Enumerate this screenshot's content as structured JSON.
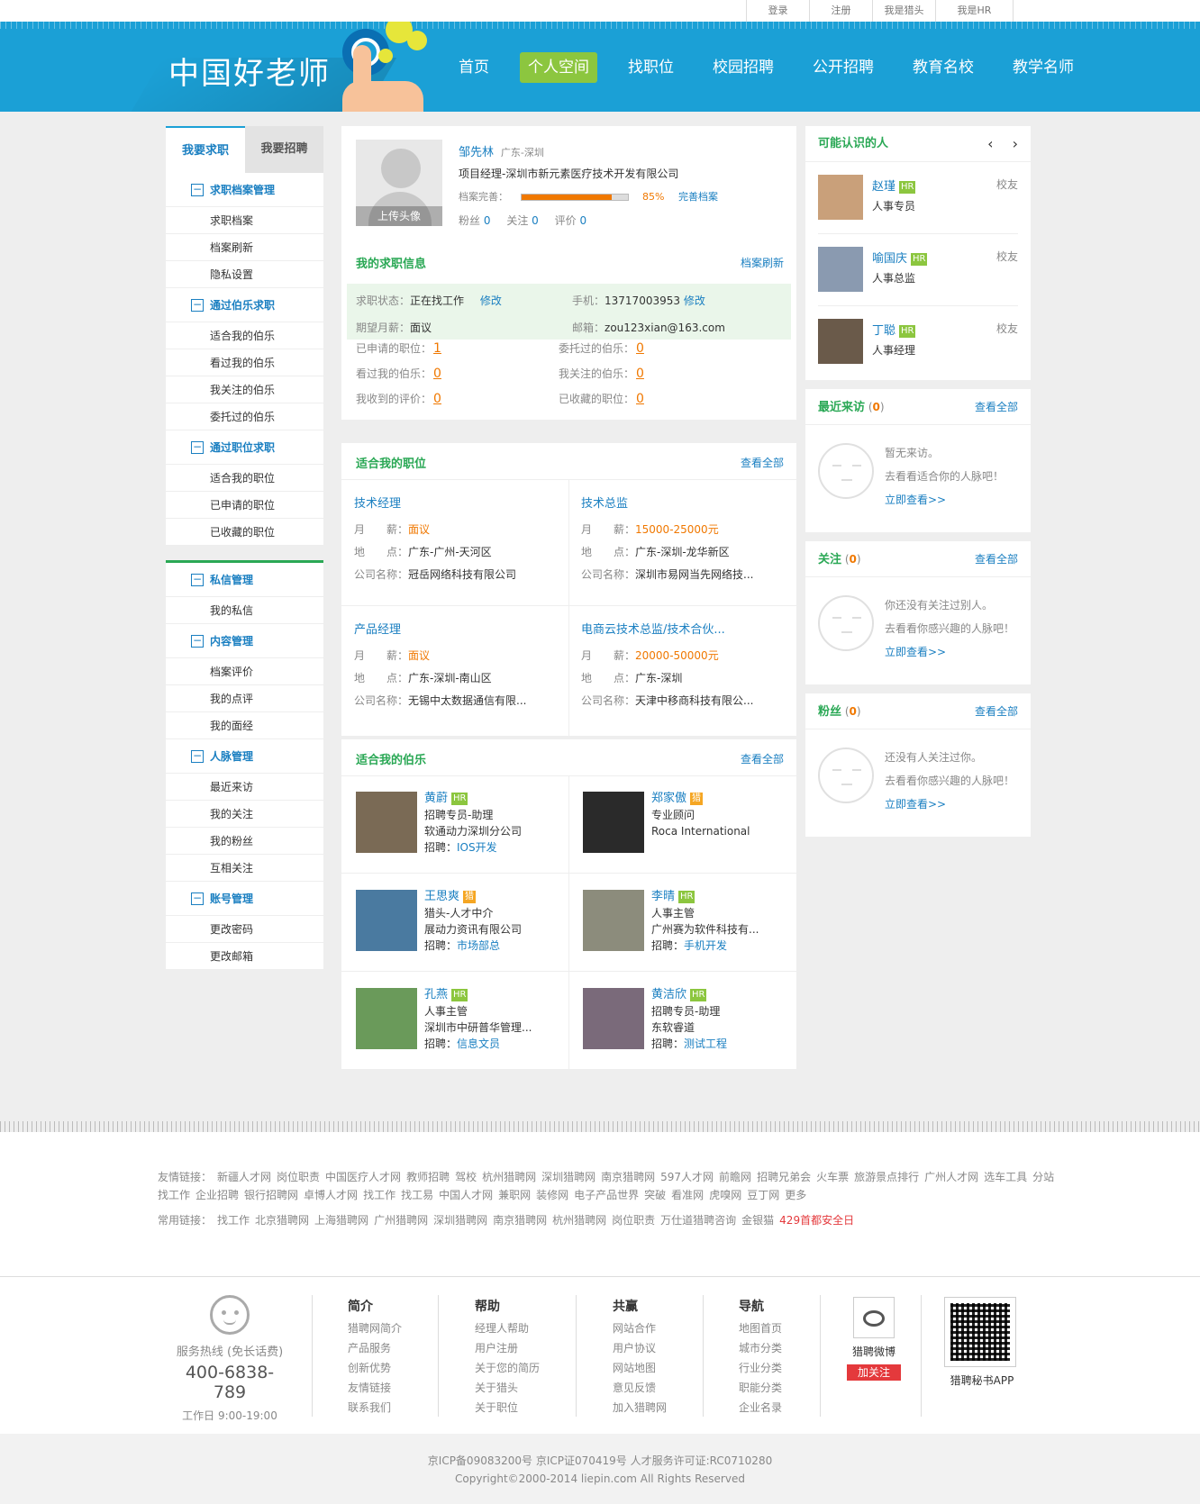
{
  "top_links": [
    "登录",
    "注册",
    "我是猎头",
    "我是HR"
  ],
  "logo_text": "中国好老师",
  "nav": [
    {
      "label": "首页",
      "active": false
    },
    {
      "label": "个人空间",
      "active": true
    },
    {
      "label": "找职位",
      "active": false
    },
    {
      "label": "校园招聘",
      "active": false
    },
    {
      "label": "公开招聘",
      "active": false
    },
    {
      "label": "教育名校",
      "active": false
    },
    {
      "label": "教学名师",
      "active": false
    }
  ],
  "sidebar": {
    "tab_active": "我要求职",
    "tab_inactive": "我要招聘",
    "groups1": [
      {
        "title": "求职档案管理",
        "items": [
          "求职档案",
          "档案刷新",
          "隐私设置"
        ]
      },
      {
        "title": "通过伯乐求职",
        "items": [
          "适合我的伯乐",
          "看过我的伯乐",
          "我关注的伯乐",
          "委托过的伯乐"
        ]
      },
      {
        "title": "通过职位求职",
        "items": [
          "适合我的职位",
          "已申请的职位",
          "已收藏的职位"
        ]
      }
    ],
    "groups2": [
      {
        "title": "私信管理",
        "items": [
          "我的私信"
        ]
      },
      {
        "title": "内容管理",
        "items": [
          "档案评价",
          "我的点评",
          "我的面经"
        ]
      },
      {
        "title": "人脉管理",
        "items": [
          "最近来访",
          "我的关注",
          "我的粉丝",
          "互相关注"
        ]
      },
      {
        "title": "账号管理",
        "items": [
          "更改密码",
          "更改邮箱"
        ]
      }
    ]
  },
  "profile": {
    "upload_label": "上传头像",
    "name": "邹先林",
    "location": "广东-深圳",
    "position": "项目经理-深圳市新元素医疗技术开发有限公司",
    "completeness_label": "档案完善：",
    "completeness_value": 0.85,
    "completeness_text": "85%",
    "complete_link": "完善档案",
    "fans_label": "粉丝",
    "fans": "0",
    "follow_label": "关注",
    "follow": "0",
    "eval_label": "评价",
    "eval": "0"
  },
  "job_info": {
    "title": "我的求职信息",
    "refresh": "档案刷新",
    "status_label": "求职状态：",
    "status": "正在找工作",
    "edit": "修改",
    "phone_label": "手机：",
    "phone": "13717003953",
    "phone_edit": "修改",
    "salary_label": "期望月薪：",
    "salary": "面议",
    "email_label": "邮箱：",
    "email": "zou123xian@163.com",
    "stats": [
      {
        "label": "已申请的职位：",
        "value": "1"
      },
      {
        "label": "委托过的伯乐：",
        "value": "0"
      },
      {
        "label": "看过我的伯乐：",
        "value": "0"
      },
      {
        "label": "我关注的伯乐：",
        "value": "0"
      },
      {
        "label": "我收到的评价：",
        "value": "0"
      },
      {
        "label": "已收藏的职位：",
        "value": "0"
      }
    ]
  },
  "jobs": {
    "title": "适合我的职位",
    "more": "查看全部",
    "salary_label": "月　　薪：",
    "place_label": "地　　点：",
    "company_label": "公司名称：",
    "items": [
      {
        "title": "技术经理",
        "salary": "面议",
        "place": "广东-广州-天河区",
        "company": "冠岳网络科技有限公司"
      },
      {
        "title": "技术总监",
        "salary": "15000-25000元",
        "place": "广东-深圳-龙华新区",
        "company": "深圳市易网当先网络技..."
      },
      {
        "title": "产品经理",
        "salary": "面议",
        "place": "广东-深圳-南山区",
        "company": "无锡中太数据通信有限..."
      },
      {
        "title": "电商云技术总监/技术合伙...",
        "salary": "20000-50000元",
        "place": "广东-深圳",
        "company": "天津中移商科技有限公..."
      }
    ]
  },
  "bole": {
    "title": "适合我的伯乐",
    "more": "查看全部",
    "recruit_label": "招聘：",
    "items": [
      {
        "name": "黄蔚",
        "tag": "HR",
        "role": "招聘专员-助理",
        "company": "软通动力深圳分公司",
        "recruit": "IOS开发",
        "color": "#7a6a55"
      },
      {
        "name": "郑家傲",
        "tag": "猎",
        "role": "专业顾问",
        "company": "Roca International",
        "recruit": "",
        "color": "#2a2a2a"
      },
      {
        "name": "王思爽",
        "tag": "猎",
        "role": "猎头-人才中介",
        "company": "展动力资讯有限公司",
        "recruit": "市场部总",
        "color": "#4a7aa0"
      },
      {
        "name": "李晴",
        "tag": "HR",
        "role": "人事主管",
        "company": "广州赛为软件科技有...",
        "recruit": "手机开发",
        "color": "#8c8c7c"
      },
      {
        "name": "孔燕",
        "tag": "HR",
        "role": "人事主管",
        "company": "深圳市中研普华管理...",
        "recruit": "信息文员",
        "color": "#6a9a5a"
      },
      {
        "name": "黄洁欣",
        "tag": "HR",
        "role": "招聘专员-助理",
        "company": "东软睿道",
        "recruit": "测试工程",
        "color": "#7a6a7a"
      }
    ]
  },
  "people": {
    "title": "可能认识的人",
    "prev": "‹",
    "next": "›",
    "items": [
      {
        "name": "赵瑾",
        "tag": "HR",
        "role": "人事专员",
        "rel": "校友",
        "color": "#c9a07a"
      },
      {
        "name": "喻国庆",
        "tag": "HR",
        "role": "人事总监",
        "rel": "校友",
        "color": "#8a9ab0"
      },
      {
        "name": "丁聪",
        "tag": "HR",
        "role": "人事经理",
        "rel": "校友",
        "color": "#6a5a4a"
      }
    ]
  },
  "visitors": {
    "title": "最近来访",
    "count": "0",
    "more": "查看全部",
    "line1": "暂无来访。",
    "line2": "去看看适合你的人脉吧！",
    "link": "立即查看>>"
  },
  "follows": {
    "title": "关注",
    "count": "0",
    "more": "查看全部",
    "line1": "你还没有关注过别人。",
    "line2": "去看看你感兴趣的人脉吧！",
    "link": "立即查看>>"
  },
  "fans": {
    "title": "粉丝",
    "count": "0",
    "more": "查看全部",
    "line1": "还没有人关注过你。",
    "line2": "去看看你感兴趣的人脉吧！",
    "link": "立即查看>>"
  },
  "footer": {
    "friend_label": "友情链接：",
    "friend_links": [
      "新疆人才网",
      "岗位职责",
      "中国医疗人才网",
      "教师招聘",
      "驾校",
      "杭州猎聘网",
      "深圳猎聘网",
      "南京猎聘网",
      "597人才网",
      "前瞻网",
      "招聘兄弟会",
      "火车票",
      "旅游景点排行",
      "广州人才网",
      "选车工具",
      "分站找工作",
      "企业招聘",
      "银行招聘网",
      "卓博人才网",
      "找工作",
      "找工易",
      "中国人才网",
      "兼职网",
      "装修网",
      "电子产品世界",
      "突破",
      "看准网",
      "虎嗅网",
      "豆丁网",
      "更多"
    ],
    "common_label": "常用链接：",
    "common_links": [
      "找工作",
      "北京猎聘网",
      "上海猎聘网",
      "广州猎聘网",
      "深圳猎聘网",
      "南京猎聘网",
      "杭州猎聘网",
      "岗位职责",
      "万仕道猎聘咨询",
      "金银猫"
    ],
    "common_highlight": "429首都安全日",
    "service_label": "服务热线 (免长话费)",
    "hotline": "400-6838-789",
    "hours": "工作日 9:00-19:00",
    "cols": [
      {
        "title": "简介",
        "items": [
          "猎聘网简介",
          "产品服务",
          "创新优势",
          "友情链接",
          "联系我们"
        ]
      },
      {
        "title": "帮助",
        "items": [
          "经理人帮助",
          "用户注册",
          "关于您的简历",
          "关于猎头",
          "关于职位"
        ]
      },
      {
        "title": "共赢",
        "items": [
          "网站合作",
          "用户协议",
          "网站地图",
          "意见反馈",
          "加入猎聘网"
        ]
      },
      {
        "title": "导航",
        "items": [
          "地图首页",
          "城市分类",
          "行业分类",
          "职能分类",
          "企业名录"
        ]
      }
    ],
    "weibo_label": "猎聘微博",
    "weibo_follow": "加关注",
    "app_label": "猎聘秘书APP",
    "icp": "京ICP备09083200号 京ICP证070419号 人才服务许可证:RC0710280",
    "copyright": "Copyright©2000-2014 liepin.com All Rights Reserved"
  }
}
